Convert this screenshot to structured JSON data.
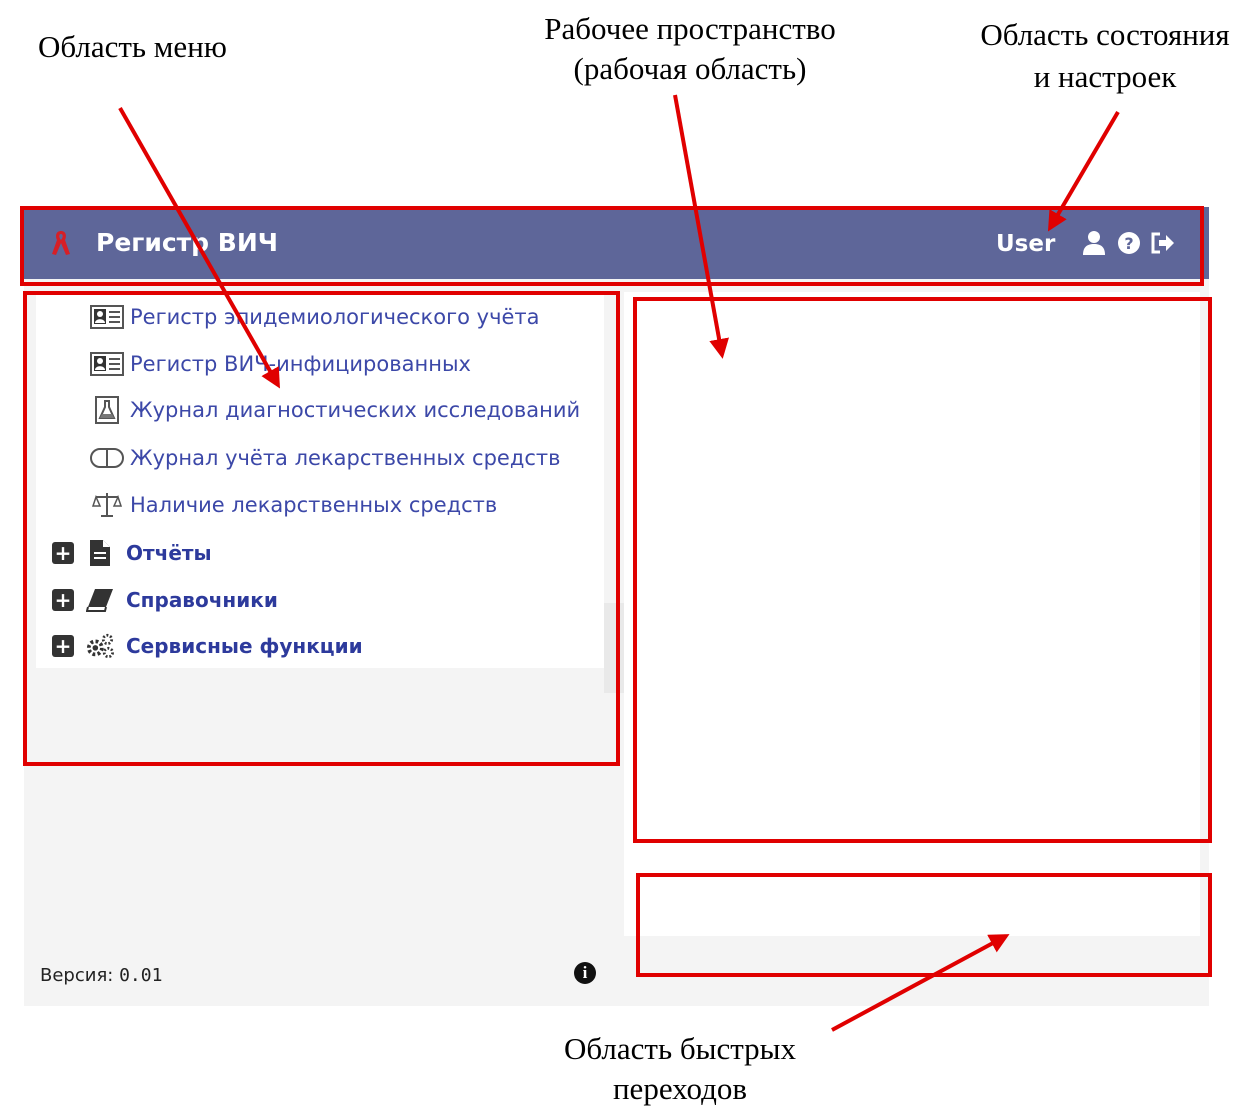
{
  "annotations": {
    "menu_area": "Область меню",
    "workspace_line1": "Рабочее пространство",
    "workspace_line2": "(рабочая область)",
    "status_line1": "Область состояния",
    "status_line2": "и настроек",
    "quick_line1": "Область быстрых",
    "quick_line2": "переходов"
  },
  "header": {
    "app_title": "Регистр ВИЧ",
    "user": "User",
    "logo_icon": "red-ribbon-icon",
    "icons": [
      "user-icon",
      "help-icon",
      "logout-icon"
    ]
  },
  "menu": {
    "items": [
      {
        "label": "Регистр эпидемиологического учёта",
        "icon": "id-card-icon"
      },
      {
        "label": "Регистр ВИЧ-инфицированных",
        "icon": "id-card-icon"
      },
      {
        "label": "Журнал диагностических исследований",
        "icon": "lab-flask-icon"
      },
      {
        "label": "Журнал учёта лекарственных средств",
        "icon": "pill-capsule-icon"
      },
      {
        "label": "Наличие лекарственных средств",
        "icon": "scales-icon"
      }
    ],
    "groups": [
      {
        "label": "Отчёты",
        "icon": "document-icon"
      },
      {
        "label": "Справочники",
        "icon": "book-icon"
      },
      {
        "label": "Сервисные функции",
        "icon": "gears-icon"
      }
    ]
  },
  "footer": {
    "version_label": "Версия:",
    "version_value": "0.01"
  },
  "colors": {
    "header_bg": "#5e6699",
    "highlight": "#e00000",
    "menu_link": "#3c48a8"
  }
}
